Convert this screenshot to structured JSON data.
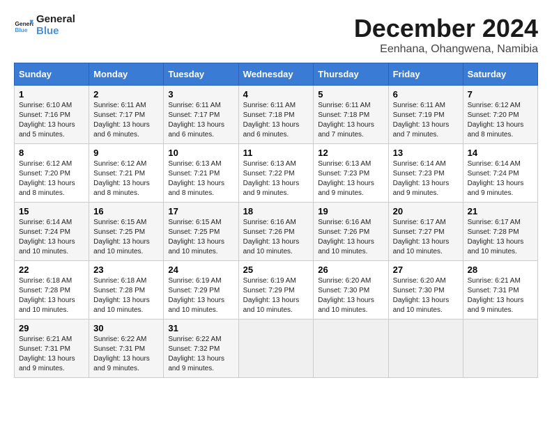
{
  "header": {
    "logo_line1": "General",
    "logo_line2": "Blue",
    "month_title": "December 2024",
    "location": "Eenhana, Ohangwena, Namibia"
  },
  "days_of_week": [
    "Sunday",
    "Monday",
    "Tuesday",
    "Wednesday",
    "Thursday",
    "Friday",
    "Saturday"
  ],
  "weeks": [
    [
      {
        "day": "1",
        "sunrise": "6:10 AM",
        "sunset": "7:16 PM",
        "daylight": "13 hours and 5 minutes."
      },
      {
        "day": "2",
        "sunrise": "6:11 AM",
        "sunset": "7:17 PM",
        "daylight": "13 hours and 6 minutes."
      },
      {
        "day": "3",
        "sunrise": "6:11 AM",
        "sunset": "7:17 PM",
        "daylight": "13 hours and 6 minutes."
      },
      {
        "day": "4",
        "sunrise": "6:11 AM",
        "sunset": "7:18 PM",
        "daylight": "13 hours and 6 minutes."
      },
      {
        "day": "5",
        "sunrise": "6:11 AM",
        "sunset": "7:18 PM",
        "daylight": "13 hours and 7 minutes."
      },
      {
        "day": "6",
        "sunrise": "6:11 AM",
        "sunset": "7:19 PM",
        "daylight": "13 hours and 7 minutes."
      },
      {
        "day": "7",
        "sunrise": "6:12 AM",
        "sunset": "7:20 PM",
        "daylight": "13 hours and 8 minutes."
      }
    ],
    [
      {
        "day": "8",
        "sunrise": "6:12 AM",
        "sunset": "7:20 PM",
        "daylight": "13 hours and 8 minutes."
      },
      {
        "day": "9",
        "sunrise": "6:12 AM",
        "sunset": "7:21 PM",
        "daylight": "13 hours and 8 minutes."
      },
      {
        "day": "10",
        "sunrise": "6:13 AM",
        "sunset": "7:21 PM",
        "daylight": "13 hours and 8 minutes."
      },
      {
        "day": "11",
        "sunrise": "6:13 AM",
        "sunset": "7:22 PM",
        "daylight": "13 hours and 9 minutes."
      },
      {
        "day": "12",
        "sunrise": "6:13 AM",
        "sunset": "7:23 PM",
        "daylight": "13 hours and 9 minutes."
      },
      {
        "day": "13",
        "sunrise": "6:14 AM",
        "sunset": "7:23 PM",
        "daylight": "13 hours and 9 minutes."
      },
      {
        "day": "14",
        "sunrise": "6:14 AM",
        "sunset": "7:24 PM",
        "daylight": "13 hours and 9 minutes."
      }
    ],
    [
      {
        "day": "15",
        "sunrise": "6:14 AM",
        "sunset": "7:24 PM",
        "daylight": "13 hours and 10 minutes."
      },
      {
        "day": "16",
        "sunrise": "6:15 AM",
        "sunset": "7:25 PM",
        "daylight": "13 hours and 10 minutes."
      },
      {
        "day": "17",
        "sunrise": "6:15 AM",
        "sunset": "7:25 PM",
        "daylight": "13 hours and 10 minutes."
      },
      {
        "day": "18",
        "sunrise": "6:16 AM",
        "sunset": "7:26 PM",
        "daylight": "13 hours and 10 minutes."
      },
      {
        "day": "19",
        "sunrise": "6:16 AM",
        "sunset": "7:26 PM",
        "daylight": "13 hours and 10 minutes."
      },
      {
        "day": "20",
        "sunrise": "6:17 AM",
        "sunset": "7:27 PM",
        "daylight": "13 hours and 10 minutes."
      },
      {
        "day": "21",
        "sunrise": "6:17 AM",
        "sunset": "7:28 PM",
        "daylight": "13 hours and 10 minutes."
      }
    ],
    [
      {
        "day": "22",
        "sunrise": "6:18 AM",
        "sunset": "7:28 PM",
        "daylight": "13 hours and 10 minutes."
      },
      {
        "day": "23",
        "sunrise": "6:18 AM",
        "sunset": "7:28 PM",
        "daylight": "13 hours and 10 minutes."
      },
      {
        "day": "24",
        "sunrise": "6:19 AM",
        "sunset": "7:29 PM",
        "daylight": "13 hours and 10 minutes."
      },
      {
        "day": "25",
        "sunrise": "6:19 AM",
        "sunset": "7:29 PM",
        "daylight": "13 hours and 10 minutes."
      },
      {
        "day": "26",
        "sunrise": "6:20 AM",
        "sunset": "7:30 PM",
        "daylight": "13 hours and 10 minutes."
      },
      {
        "day": "27",
        "sunrise": "6:20 AM",
        "sunset": "7:30 PM",
        "daylight": "13 hours and 10 minutes."
      },
      {
        "day": "28",
        "sunrise": "6:21 AM",
        "sunset": "7:31 PM",
        "daylight": "13 hours and 9 minutes."
      }
    ],
    [
      {
        "day": "29",
        "sunrise": "6:21 AM",
        "sunset": "7:31 PM",
        "daylight": "13 hours and 9 minutes."
      },
      {
        "day": "30",
        "sunrise": "6:22 AM",
        "sunset": "7:31 PM",
        "daylight": "13 hours and 9 minutes."
      },
      {
        "day": "31",
        "sunrise": "6:22 AM",
        "sunset": "7:32 PM",
        "daylight": "13 hours and 9 minutes."
      },
      null,
      null,
      null,
      null
    ]
  ]
}
